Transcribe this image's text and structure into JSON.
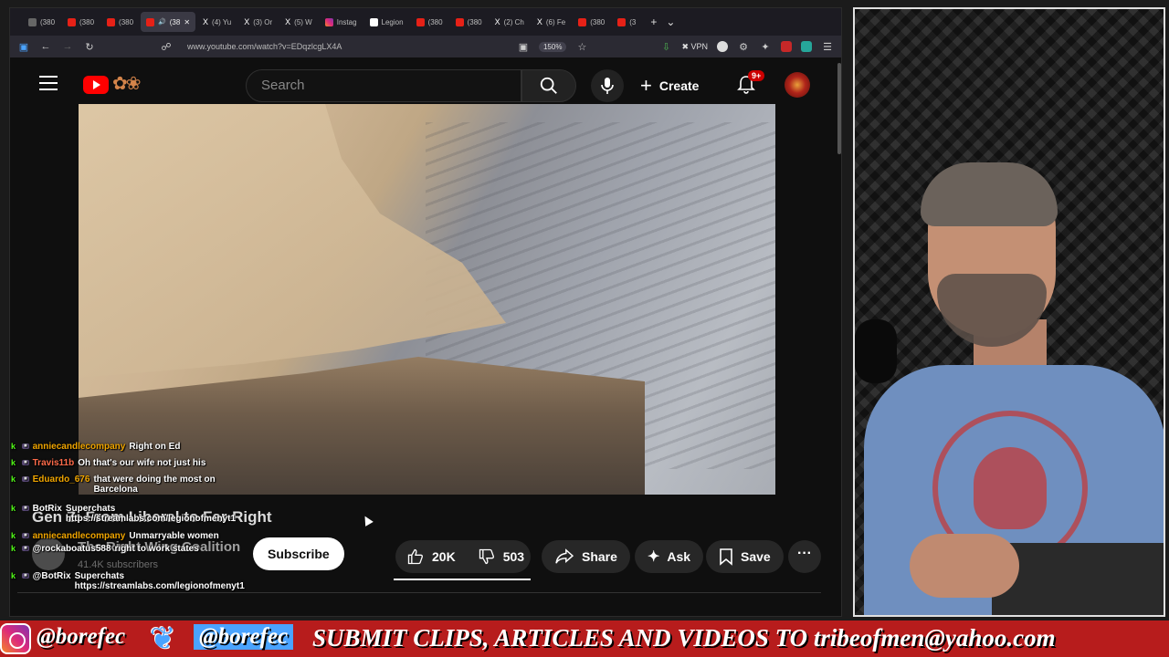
{
  "browser": {
    "tabs": [
      {
        "label": "(380",
        "icon": "youtube-icon"
      },
      {
        "label": "(380",
        "icon": "youtube-icon"
      },
      {
        "label": "(38",
        "icon": "youtube-icon",
        "active": true
      },
      {
        "label": "(4) Yu",
        "icon": "x-icon"
      },
      {
        "label": "(3) Or",
        "icon": "x-icon"
      },
      {
        "label": "(5) W",
        "icon": "x-icon"
      },
      {
        "label": "Instag",
        "icon": "instagram-icon"
      },
      {
        "label": "Legion",
        "icon": "doc-icon"
      },
      {
        "label": "(380",
        "icon": "youtube-icon"
      },
      {
        "label": "(380",
        "icon": "youtube-icon"
      },
      {
        "label": "(2) Ch",
        "icon": "x-icon"
      },
      {
        "label": "(6) Fe",
        "icon": "x-icon"
      },
      {
        "label": "(380",
        "icon": "youtube-icon"
      },
      {
        "label": "(3",
        "icon": "youtube-icon"
      }
    ],
    "first_tab": "(380",
    "url": "www.youtube.com/watch?v=EDqzlcgLX4A",
    "zoom": "150%",
    "vpn_label": "VPN"
  },
  "yt": {
    "search_placeholder": "Search",
    "create_label": "Create",
    "notif_badge": "9+"
  },
  "chat": [
    {
      "user": "anniecandlecompany",
      "user_color": "#f0a500",
      "msg": "Right on Ed"
    },
    {
      "user": "Travis11b",
      "user_color": "#ff6b4a",
      "msg": "Oh that's our wife not just his"
    },
    {
      "user": "Eduardo_676",
      "user_color": "#f0a500",
      "msg": "that were doing the most on Barcelona"
    },
    {
      "user": "BotRix",
      "user_color": "#ffffff",
      "msg": "Superchats https://streamlabs.com/legionofmenyt1"
    },
    {
      "user": "anniecandlecompany",
      "user_color": "#f0a500",
      "msg": "Unmarryable women"
    },
    {
      "user": "@rockaboatus588",
      "user_color": "#ffffff",
      "msg": "right to work states"
    },
    {
      "user": "@BotRix",
      "user_color": "#ffffff",
      "msg": "Superchats https://streamlabs.com/legionofmenyt1"
    }
  ],
  "video": {
    "title": "Gen Z: From Liberal to Far-Right",
    "channel": "The Right Wing Coalition",
    "subs": "41.4K subscribers",
    "subscribe_label": "Subscribe",
    "likes": "20K",
    "dislikes": "503",
    "share_label": "Share",
    "ask_label": "Ask",
    "save_label": "Save"
  },
  "banner": {
    "handle_ig": "@borefec",
    "handle_tw": "@borefec",
    "slogan": "SUBMIT CLIPS, ARTICLES AND VIDEOS TO tribeofmen@yahoo.com"
  },
  "colors": {
    "yt_red": "#ff0000",
    "banner_red": "#b71c1c",
    "twitter_blue": "#4aa3ff",
    "chat_green": "#53fc18"
  }
}
